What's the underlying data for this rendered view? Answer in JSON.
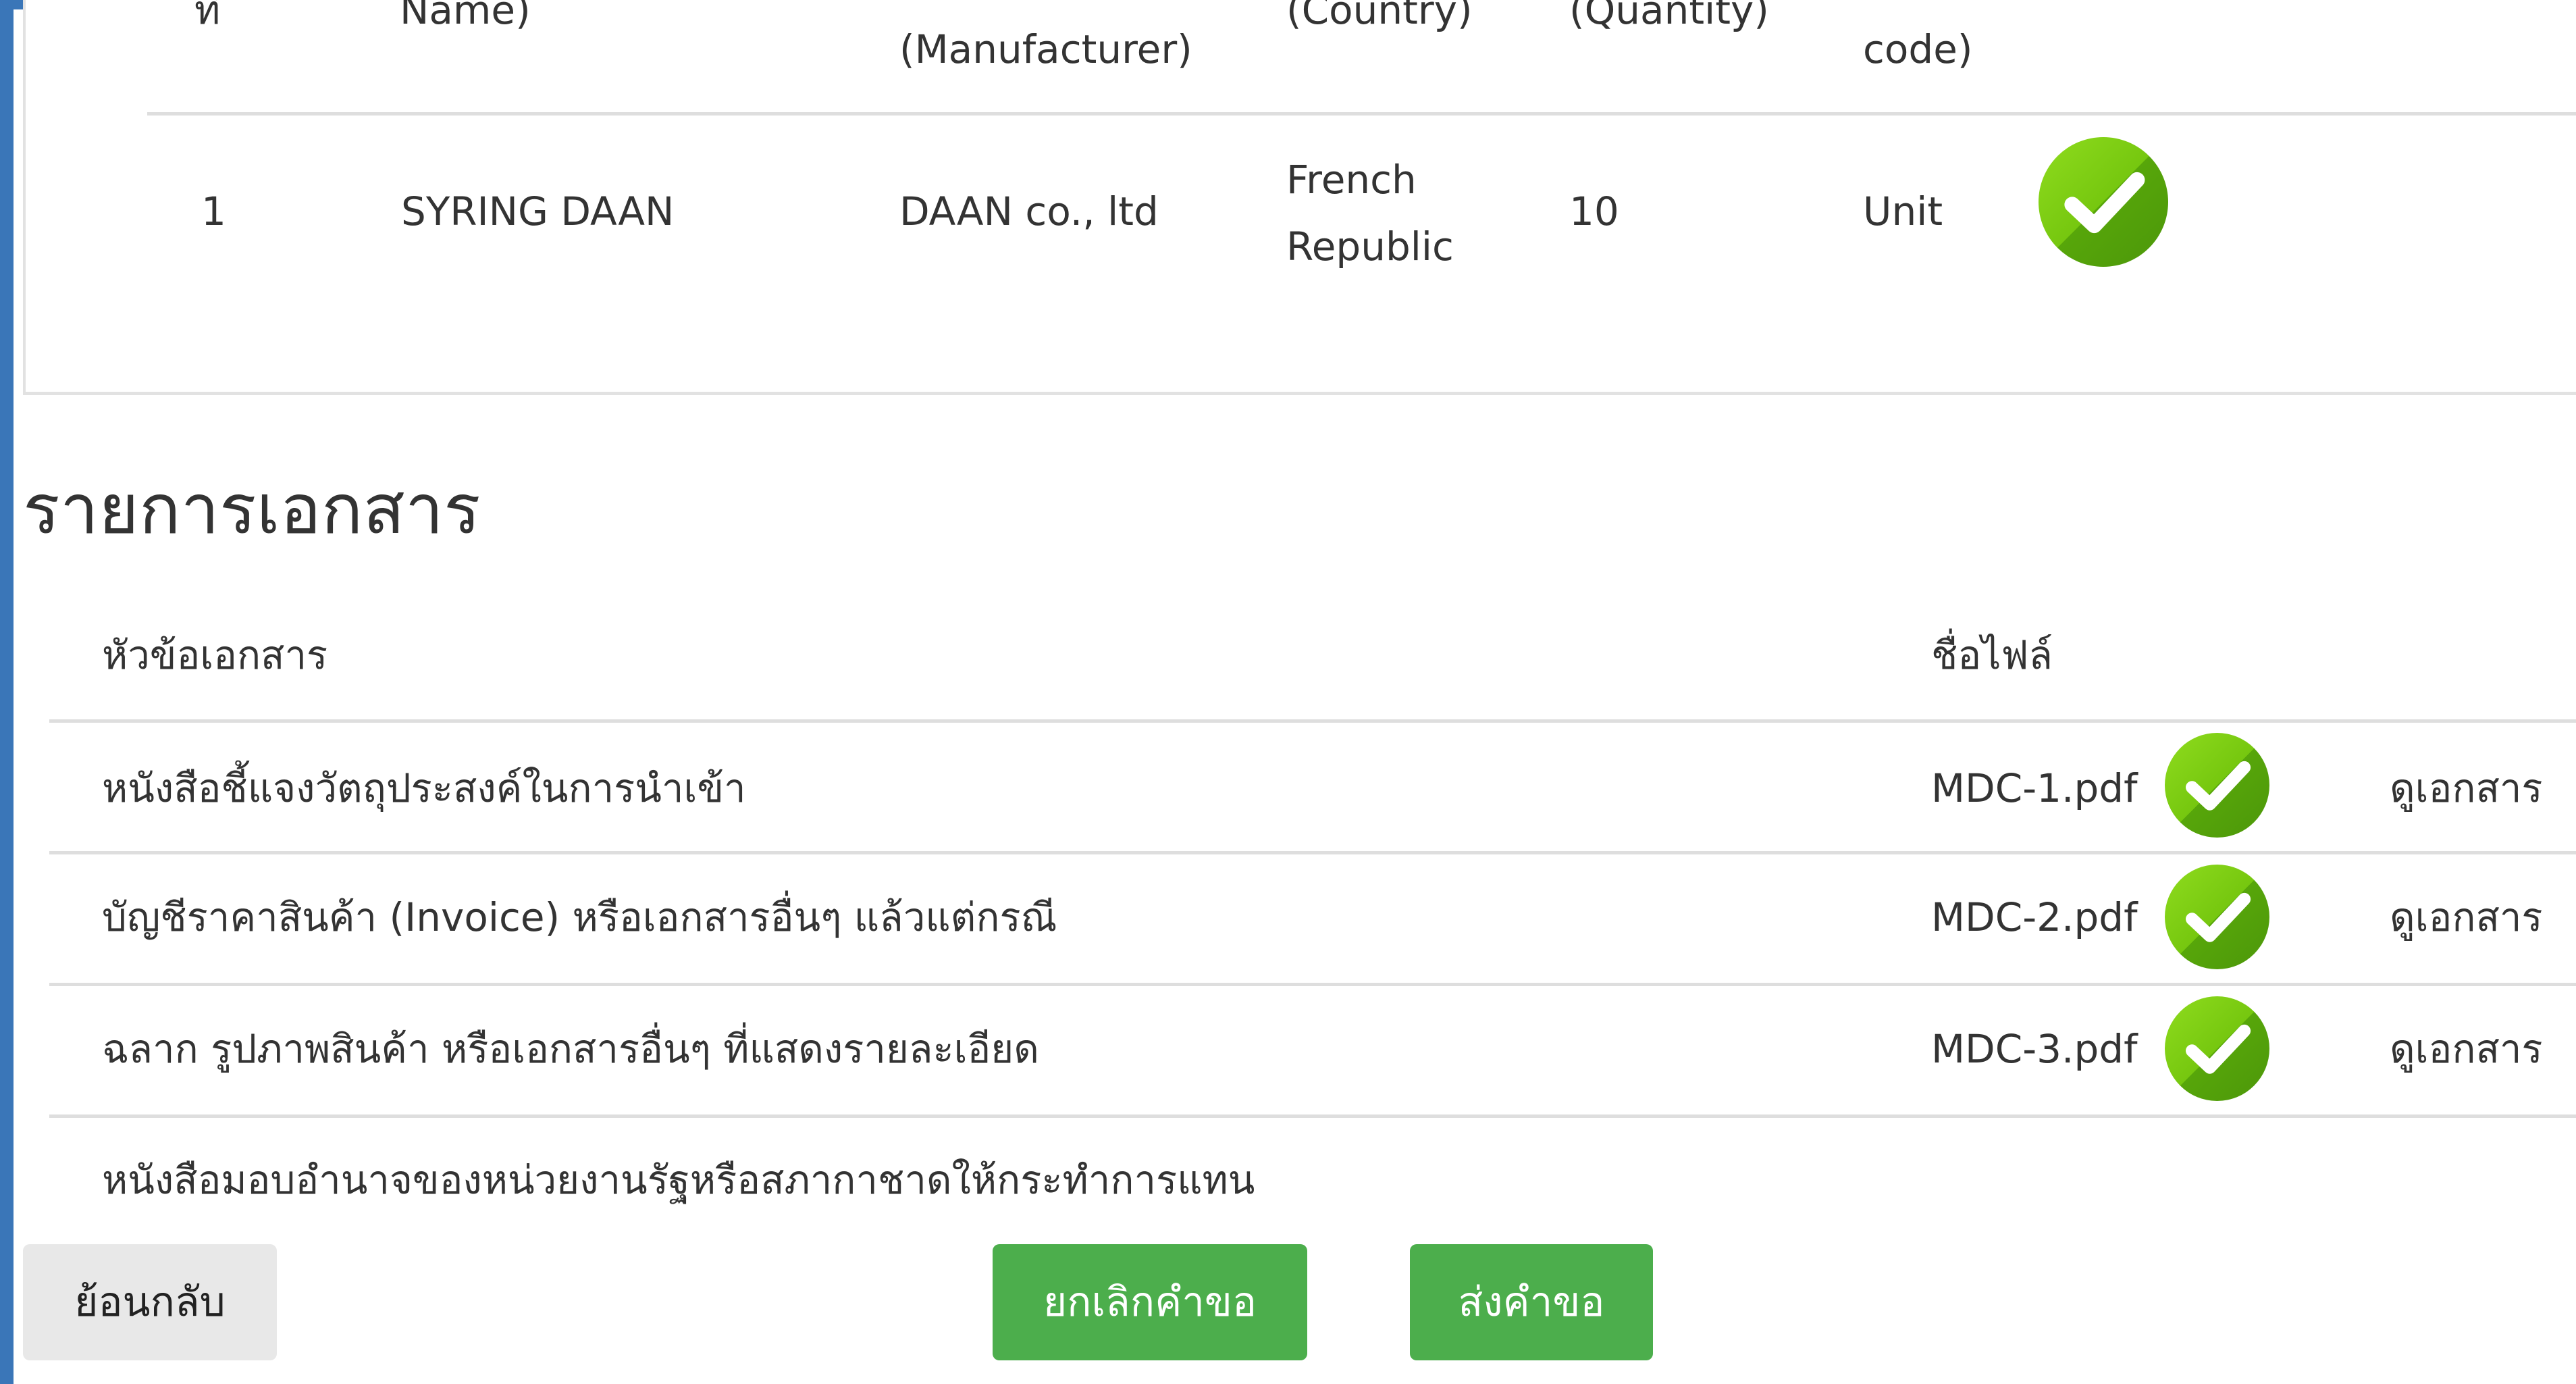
{
  "product_table": {
    "headers": {
      "col1": "ที่",
      "col2": "Name)",
      "col3": "(Manufacturer)",
      "col4": "(Country)",
      "col5": "(Quantity)",
      "col6": "code)"
    },
    "rows": [
      {
        "no": "1",
        "name": "SYRING DAAN",
        "manufacturer": "DAAN co., ltd",
        "country_line1": "French",
        "country_line2": "Republic",
        "quantity": "10",
        "unit": "Unit",
        "status_icon": "check-icon"
      }
    ]
  },
  "documents": {
    "title": "รายการเอกสาร",
    "header_topic": "หัวข้อเอกสาร",
    "header_filename": "ชื่อไฟล์",
    "rows": [
      {
        "topic": "หนังสือชี้แจงวัตถุประสงค์ในการนำเข้า",
        "file": "MDC-1.pdf",
        "view": "ดูเอกสาร"
      },
      {
        "topic": "บัญชีราคาสินค้า (Invoice) หรือเอกสารอื่นๆ แล้วแต่กรณี",
        "file": "MDC-2.pdf",
        "view": "ดูเอกสาร"
      },
      {
        "topic": "ฉลาก รูปภาพสินค้า หรือเอกสารอื่นๆ ที่แสดงรายละเอียด",
        "file": "MDC-3.pdf",
        "view": "ดูเอกสาร"
      },
      {
        "topic": "หนังสือมอบอำนาจของหน่วยงานรัฐหรือสภากาชาดให้กระทำการแทน"
      }
    ]
  },
  "actions": {
    "back": "ย้อนกลับ",
    "cancel": "ยกเลิกคำขอ",
    "submit": "ส่งคำขอ"
  },
  "colors": {
    "frame": "#3a76b8",
    "button_green": "#4cae4c",
    "button_gray": "#e8e8e8",
    "check_green": "#76c70f"
  }
}
